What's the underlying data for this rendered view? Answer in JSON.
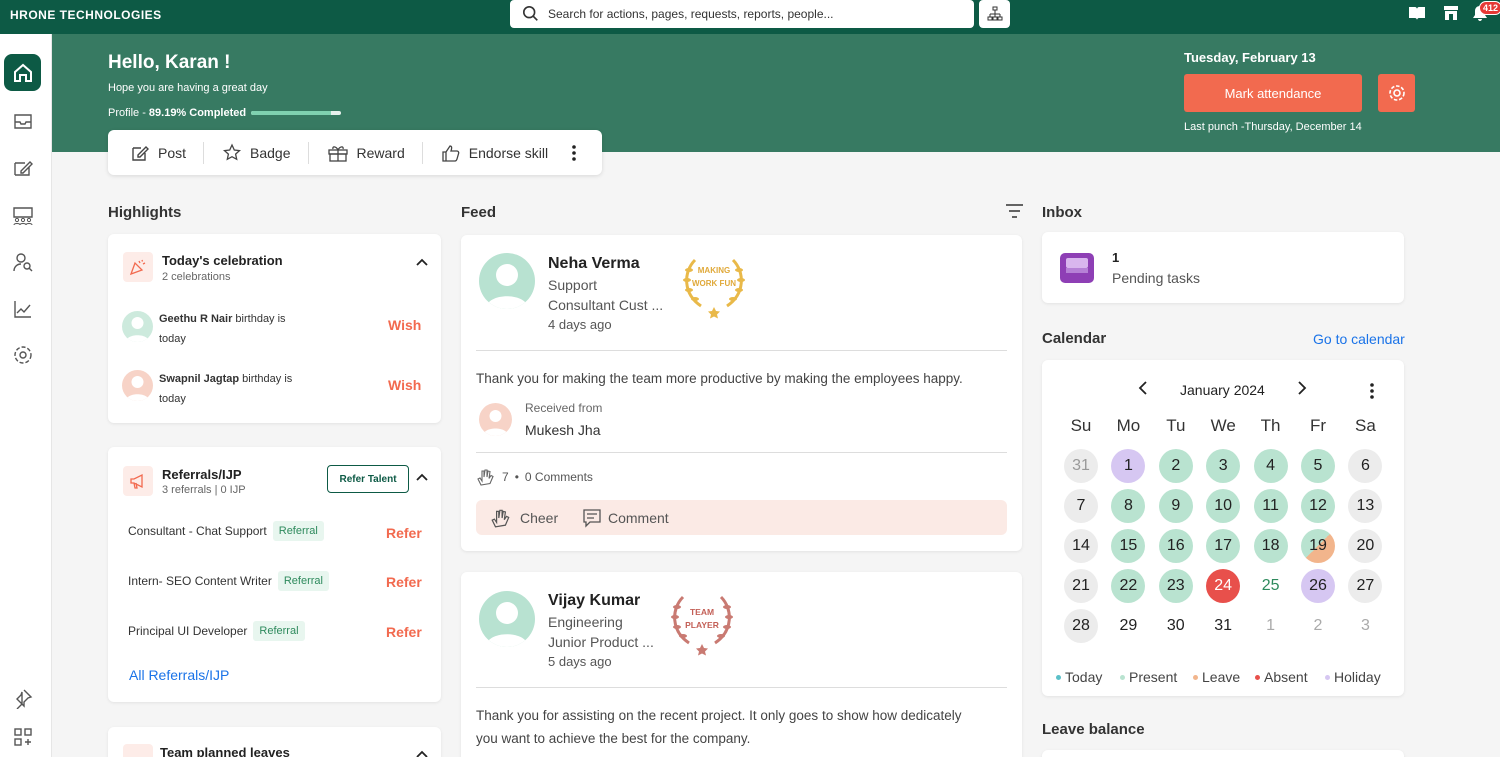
{
  "brand": "HRONE TECHNOLOGIES",
  "search": {
    "placeholder": "Search for actions, pages, requests, reports, people..."
  },
  "notifications": {
    "count": "412"
  },
  "hero": {
    "greeting": "Hello, Karan !",
    "subtitle": "Hope you are having a great day",
    "profile_label": "Profile -",
    "profile_value": "89.19% Completed",
    "profile_progress": 0.8919,
    "date": "Tuesday, February 13",
    "mark_attendance": "Mark attendance",
    "last_punch": "Last punch -Thursday, December 14"
  },
  "actions": [
    {
      "label": "Post",
      "icon": "edit-icon"
    },
    {
      "label": "Badge",
      "icon": "star-icon"
    },
    {
      "label": "Reward",
      "icon": "gift-icon"
    },
    {
      "label": "Endorse skill",
      "icon": "thumbs-up-icon"
    }
  ],
  "highlights": {
    "title": "Highlights",
    "celebration": {
      "title": "Today's celebration",
      "subtitle": "2 celebrations",
      "items": [
        {
          "name": "Geethu R Nair",
          "text_a": "birthday is",
          "text_b": "today",
          "action": "Wish"
        },
        {
          "name": "Swapnil Jagtap",
          "text_a": "birthday is",
          "text_b": "today",
          "action": "Wish"
        }
      ]
    },
    "referrals": {
      "title": "Referrals/IJP",
      "subtitle": "3 referrals | 0 IJP",
      "button": "Refer Talent",
      "items": [
        {
          "role": "Consultant - Chat Support",
          "chip": "Referral",
          "action": "Refer"
        },
        {
          "role": "Intern- SEO Content Writer",
          "chip": "Referral",
          "action": "Refer"
        },
        {
          "role": "Principal UI Developer",
          "chip": "Referral",
          "action": "Refer"
        }
      ],
      "all_link": "All Referrals/IJP"
    },
    "team_leaves": {
      "title": "Team planned leaves"
    }
  },
  "feed": {
    "title": "Feed",
    "posts": [
      {
        "name": "Neha Verma",
        "dept": "Support",
        "role": "Consultant Cust ...",
        "time": "4 days ago",
        "badge_text": "MAKING WORK FUN",
        "message": "Thank you for making the team more productive by making the employees happy.",
        "received_label": "Received from",
        "received_from": "Mukesh Jha",
        "reactions": "7",
        "comments": "0 Comments",
        "cheer": "Cheer",
        "comment": "Comment"
      },
      {
        "name": "Vijay Kumar",
        "dept": "Engineering",
        "role": "Junior Product ...",
        "time": "5 days ago",
        "badge_text": "TEAM PLAYER",
        "message_l1": "Thank you for assisting on the recent project. It only goes to show how dedicately",
        "message_l2": "you want to achieve the best for the company."
      }
    ]
  },
  "inbox": {
    "title": "Inbox",
    "count": "1",
    "label": "Pending tasks"
  },
  "calendar": {
    "title": "Calendar",
    "link": "Go to calendar",
    "month": "January 2024",
    "weekdays": [
      "Su",
      "Mo",
      "Tu",
      "We",
      "Th",
      "Fr",
      "Sa"
    ],
    "days": [
      [
        "31",
        "1",
        "2",
        "3",
        "4",
        "5",
        "6"
      ],
      [
        "7",
        "8",
        "9",
        "10",
        "11",
        "12",
        "13"
      ],
      [
        "14",
        "15",
        "16",
        "17",
        "18",
        "19",
        "20"
      ],
      [
        "21",
        "22",
        "23",
        "24",
        "25",
        "26",
        "27"
      ],
      [
        "28",
        "29",
        "30",
        "31",
        "1",
        "2",
        "3"
      ]
    ],
    "legend": [
      "Today",
      "Present",
      "Leave",
      "Absent",
      "Holiday"
    ],
    "colors": {
      "present": "#b9e3d0",
      "holiday": "#d6c7f2",
      "absent": "#e8504b",
      "weekend": "#ececec",
      "today": "#5bc0c8",
      "leave": "#f2b58c"
    }
  },
  "leave_balance": {
    "title": "Leave balance"
  }
}
